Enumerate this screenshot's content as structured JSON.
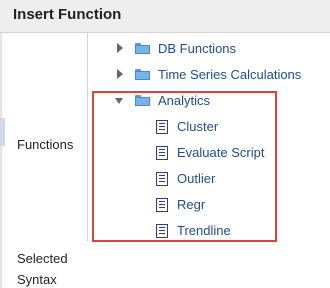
{
  "dialog": {
    "title": "Insert Function",
    "labels": {
      "functions": "Functions",
      "selected": "Selected",
      "syntax": "Syntax"
    }
  },
  "tree": {
    "items": [
      {
        "label": "DB Functions",
        "type": "folder",
        "expanded": false,
        "icon": "folder-icon"
      },
      {
        "label": "Time Series Calculations",
        "type": "folder",
        "expanded": false,
        "icon": "folder-icon"
      },
      {
        "label": "Analytics",
        "type": "folder",
        "expanded": true,
        "icon": "folder-icon",
        "children": [
          {
            "label": "Cluster",
            "icon": "function-document-icon"
          },
          {
            "label": "Evaluate Script",
            "icon": "function-document-icon"
          },
          {
            "label": "Outlier",
            "icon": "function-document-icon"
          },
          {
            "label": "Regr",
            "icon": "function-document-icon"
          },
          {
            "label": "Trendline",
            "icon": "function-document-icon"
          }
        ]
      }
    ]
  },
  "colors": {
    "title_bar": "#eeeeee",
    "tree_text": "#1f4e8c",
    "highlight_border": "#d9443c",
    "folder": "#76b3ea"
  }
}
